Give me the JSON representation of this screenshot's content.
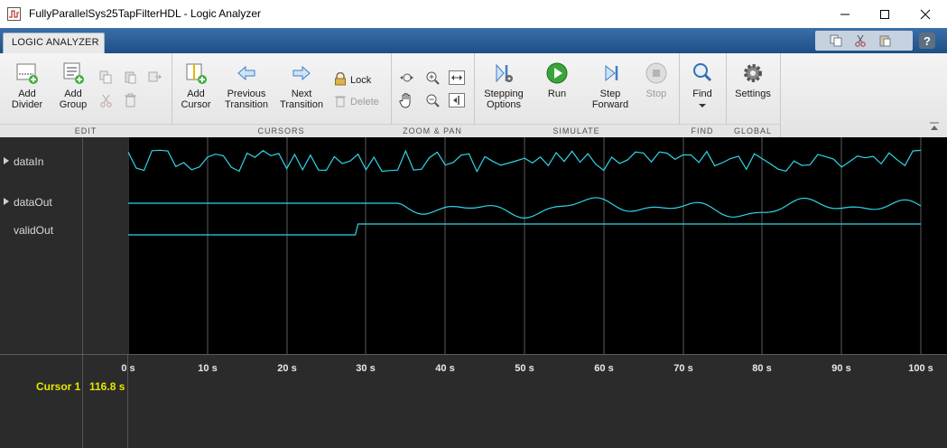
{
  "window": {
    "title": "FullyParallelSys25TapFilterHDL - Logic Analyzer",
    "icon": "logic-analyzer-app-icon"
  },
  "tabs": [
    {
      "label": "LOGIC ANALYZER",
      "active": true
    }
  ],
  "quick_access": [
    "copy-icon",
    "cut-icon",
    "paste-icon",
    "help-icon"
  ],
  "ribbon": {
    "sections": [
      {
        "label": "EDIT"
      },
      {
        "label": "CURSORS"
      },
      {
        "label": "ZOOM & PAN"
      },
      {
        "label": "SIMULATE"
      },
      {
        "label": "FIND"
      },
      {
        "label": "GLOBAL"
      }
    ],
    "edit": {
      "add_divider": "Add\nDivider",
      "add_group": "Add\nGroup"
    },
    "cursors": {
      "add_cursor": "Add\nCursor",
      "previous_transition": "Previous\nTransition",
      "next_transition": "Next\nTransition",
      "lock": "Lock",
      "delete": "Delete"
    },
    "simulate": {
      "stepping_options": "Stepping\nOptions",
      "run": "Run",
      "step_forward": "Step\nForward",
      "stop": "Stop"
    },
    "find": {
      "find": "Find"
    },
    "global": {
      "settings": "Settings"
    }
  },
  "signals": [
    {
      "name": "dataIn",
      "expandable": true
    },
    {
      "name": "dataOut",
      "expandable": true
    },
    {
      "name": "validOut",
      "expandable": false
    }
  ],
  "time_axis": {
    "ticks": [
      "0 s",
      "10 s",
      "20 s",
      "30 s",
      "40 s",
      "50 s",
      "60 s",
      "70 s",
      "80 s",
      "90 s",
      "100 s"
    ]
  },
  "cursor": {
    "label": "Cursor 1",
    "value": "116.8 s"
  },
  "colors": {
    "trace": "#2fd6e8",
    "cursor_text": "#e6e600",
    "plot_bg": "#000000",
    "panel_bg": "#2b2b2b",
    "accent": "#2a5f9e"
  }
}
